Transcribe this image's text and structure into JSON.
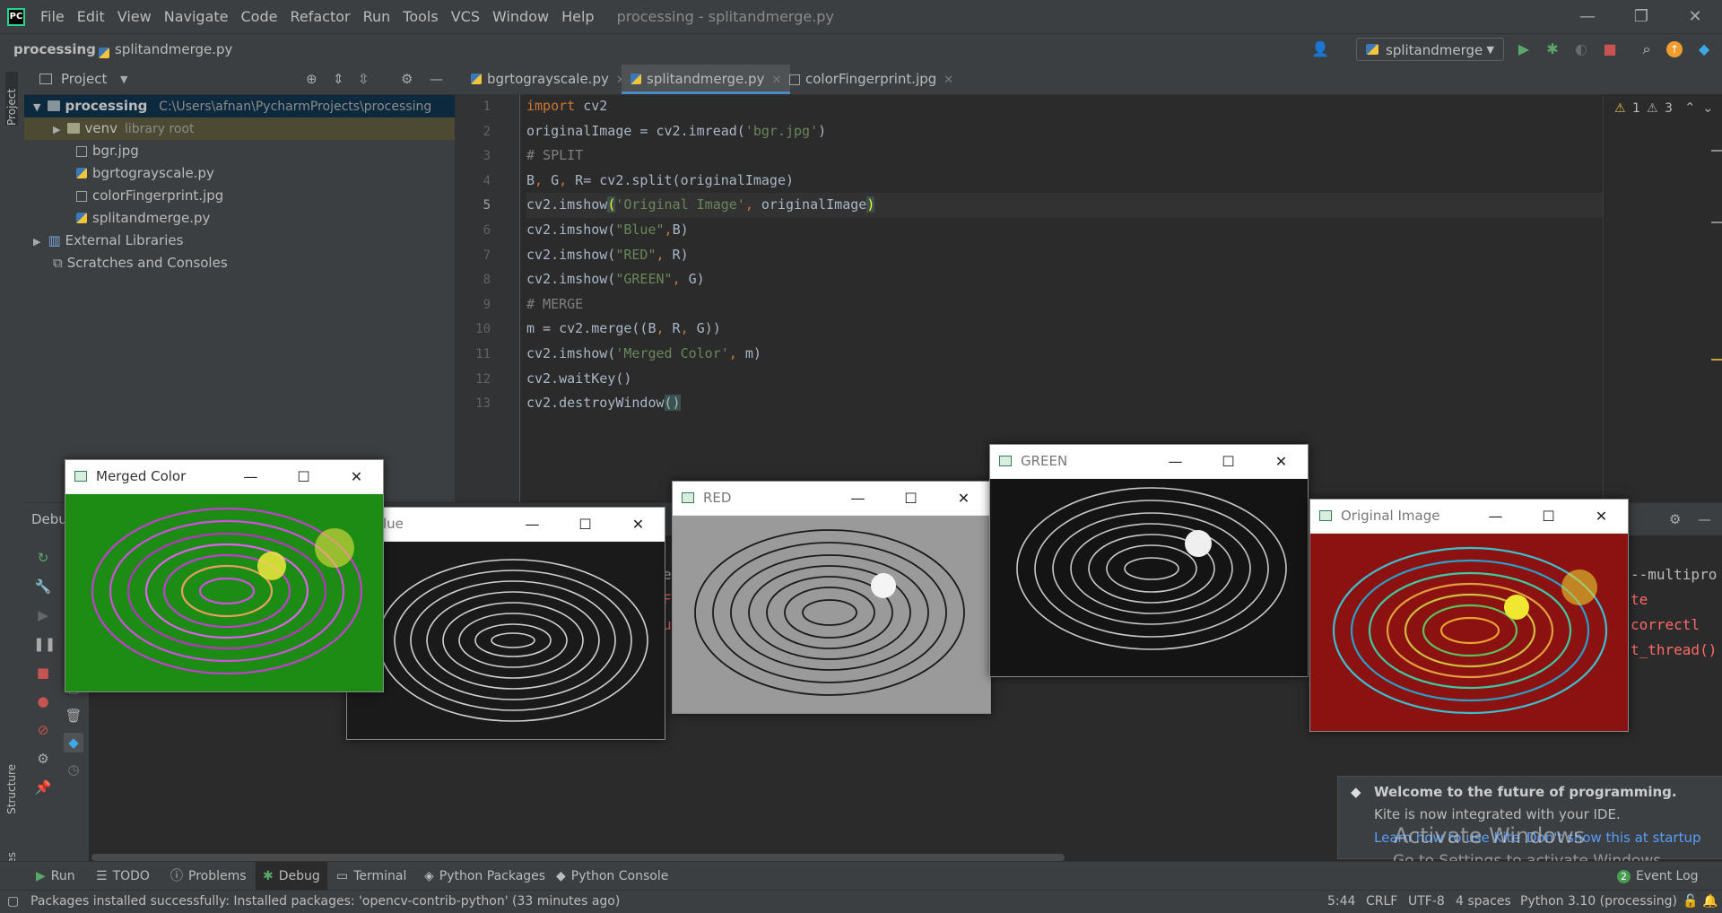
{
  "menu": {
    "items": [
      "File",
      "Edit",
      "View",
      "Navigate",
      "Code",
      "Refactor",
      "Run",
      "Tools",
      "VCS",
      "Window",
      "Help"
    ],
    "window_title": "processing - splitandmerge.py"
  },
  "navbar": {
    "project": "processing",
    "file": "splitandmerge.py",
    "run_config": "splitandmerge"
  },
  "project_panel": {
    "title": "Project",
    "root_name": "processing",
    "root_path": "C:\\Users\\afnan\\PycharmProjects\\processing",
    "venv": "venv",
    "venv_note": "library root",
    "files": [
      "bgr.jpg",
      "bgrtograyscale.py",
      "colorFingerprint.jpg",
      "splitandmerge.py"
    ],
    "external": "External Libraries",
    "scratches": "Scratches and Consoles"
  },
  "editor": {
    "tabs": [
      "bgrtograyscale.py",
      "splitandmerge.py",
      "colorFingerprint.jpg"
    ],
    "line_numbers": [
      "1",
      "2",
      "3",
      "4",
      "5",
      "6",
      "7",
      "8",
      "9",
      "10",
      "11",
      "12",
      "13"
    ],
    "warnings": "1",
    "weak_warnings": "3"
  },
  "left_strip": {
    "project": "Project",
    "structure": "Structure",
    "favorites": "Favorites"
  },
  "debug_panel": {
    "title": "Debu",
    "console_right": [
      "--multipro",
      "te correctl",
      "t_thread()"
    ],
    "console_left": [
      "e",
      "F",
      "u"
    ]
  },
  "cv_windows": {
    "merged": "Merged Color",
    "blue": "lue",
    "red": "RED",
    "green": "GREEN",
    "original": "Original Image"
  },
  "notification": {
    "title": "Welcome to the future of programming.",
    "body": "Kite is now integrated with your IDE.",
    "link1": "Learn how to use Kite",
    "link2": "Don't show this at startup"
  },
  "watermark": {
    "line1": "Activate Windows",
    "line2": "Go to Settings to activate Windows."
  },
  "tool_windows": [
    "Run",
    "TODO",
    "Problems",
    "Debug",
    "Terminal",
    "Python Packages",
    "Python Console"
  ],
  "event_log": {
    "count": "2",
    "label": "Event Log"
  },
  "status": {
    "message": "Packages installed successfully: Installed packages: 'opencv-contrib-python' (33 minutes ago)",
    "position": "5:44",
    "line_sep": "CRLF",
    "encoding": "UTF-8",
    "indent": "4 spaces",
    "interpreter": "Python 3.10 (processing)"
  }
}
